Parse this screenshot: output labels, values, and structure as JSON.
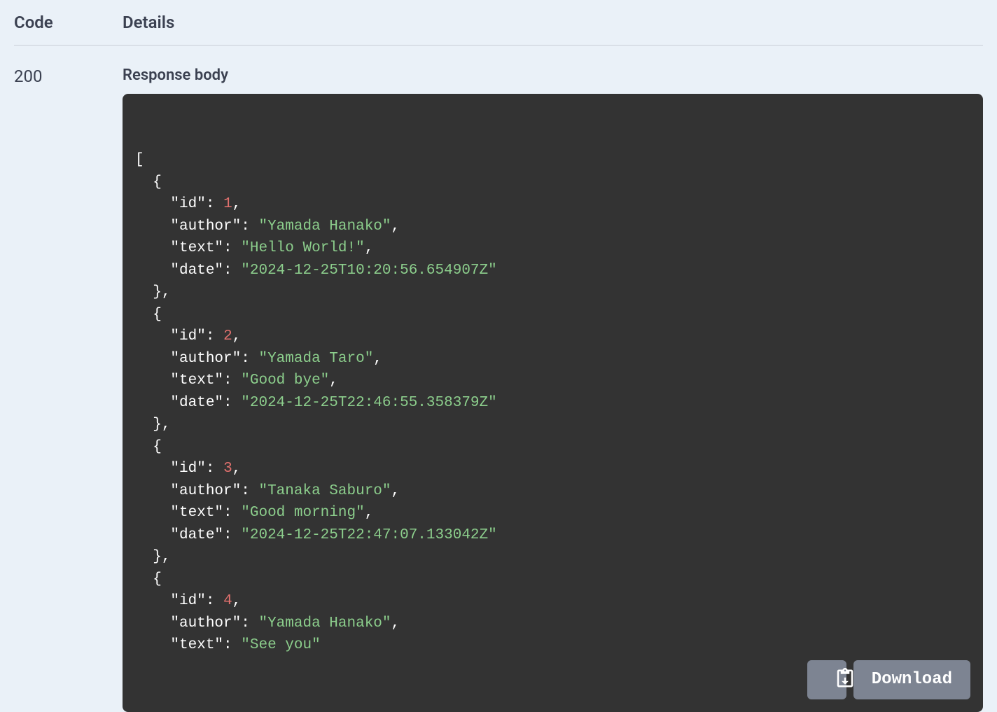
{
  "headers": {
    "code": "Code",
    "details": "Details"
  },
  "response": {
    "status_code": "200",
    "body_label": "Response body",
    "download_label": "Download",
    "items": [
      {
        "id": 1,
        "author": "Yamada Hanako",
        "text": "Hello World!",
        "date": "2024-12-25T10:20:56.654907Z"
      },
      {
        "id": 2,
        "author": "Yamada Taro",
        "text": "Good bye",
        "date": "2024-12-25T22:46:55.358379Z"
      },
      {
        "id": 3,
        "author": "Tanaka Saburo",
        "text": "Good morning",
        "date": "2024-12-25T22:47:07.133042Z"
      },
      {
        "id": 4,
        "author": "Yamada Hanako",
        "text": "See you"
      }
    ]
  }
}
